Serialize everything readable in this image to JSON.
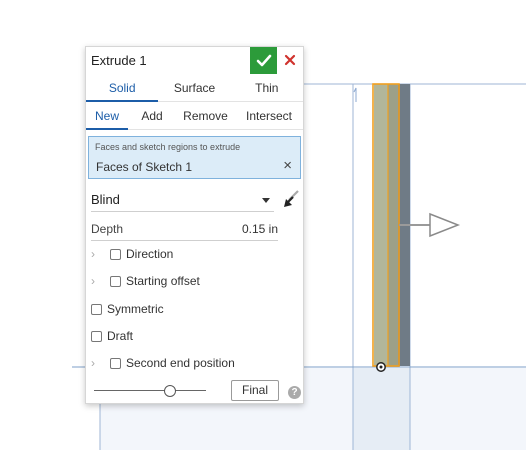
{
  "panel": {
    "title": "Extrude 1",
    "accept_icon": "checkmark-icon",
    "cancel_icon": "close-icon",
    "body_type_tabs": [
      {
        "label": "Solid",
        "active": true
      },
      {
        "label": "Surface",
        "active": false
      },
      {
        "label": "Thin",
        "active": false
      }
    ],
    "operation_tabs": [
      {
        "label": "New",
        "active": true
      },
      {
        "label": "Add",
        "active": false
      },
      {
        "label": "Remove",
        "active": false
      },
      {
        "label": "Intersect",
        "active": false
      }
    ],
    "selection": {
      "hint": "Faces and sketch regions to extrude",
      "value": "Faces of Sketch 1",
      "clear": "×"
    },
    "end_type": {
      "value": "Blind"
    },
    "depth": {
      "label": "Depth",
      "value": "0.15 in"
    },
    "options": {
      "direction": "Direction",
      "starting_offset": "Starting offset",
      "symmetric": "Symmetric",
      "draft": "Draft",
      "second_end": "Second end position"
    },
    "final_label": "Final",
    "help": "?"
  },
  "colors": {
    "accent": "#1c5da8",
    "accept": "#2c9b3a",
    "cancel": "#d0332e",
    "selection_bg": "#dcecf8",
    "highlight": "#f0a020"
  }
}
